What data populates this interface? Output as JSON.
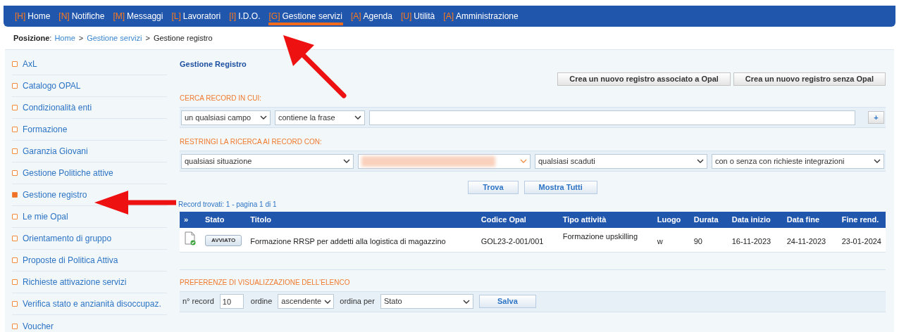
{
  "nav": [
    {
      "key": "[H]",
      "label": "Home",
      "selected": false
    },
    {
      "key": "[N]",
      "label": "Notifiche",
      "selected": false
    },
    {
      "key": "[M]",
      "label": "Messaggi",
      "selected": false
    },
    {
      "key": "[L]",
      "label": "Lavoratori",
      "selected": false
    },
    {
      "key": "[I]",
      "label": "I.D.O.",
      "selected": false
    },
    {
      "key": "[G]",
      "label": "Gestione servizi",
      "selected": true
    },
    {
      "key": "[A]",
      "label": "Agenda",
      "selected": false
    },
    {
      "key": "[U]",
      "label": "Utilità",
      "selected": false
    },
    {
      "key": "[A]",
      "label": "Amministrazione",
      "selected": false
    }
  ],
  "breadcrumb": {
    "label": "Posizione",
    "colon": ":",
    "separator": ">",
    "links": [
      "Home",
      "Gestione servizi"
    ],
    "current": "Gestione registro"
  },
  "sidebar": {
    "items": [
      {
        "label": "AxL",
        "selected": false
      },
      {
        "label": "Catalogo OPAL",
        "selected": false
      },
      {
        "label": "Condizionalità enti",
        "selected": false
      },
      {
        "label": "Formazione",
        "selected": false
      },
      {
        "label": "Garanzia Giovani",
        "selected": false
      },
      {
        "label": "Gestione Politiche attive",
        "selected": false
      },
      {
        "label": "Gestione registro",
        "selected": true
      },
      {
        "label": "Le mie Opal",
        "selected": false
      },
      {
        "label": "Orientamento di gruppo",
        "selected": false
      },
      {
        "label": "Proposte di Politica Attiva",
        "selected": false
      },
      {
        "label": "Richieste attivazione servizi",
        "selected": false
      },
      {
        "label": "Verifica stato e anzianità disoccupaz.",
        "selected": false
      },
      {
        "label": "Voucher",
        "selected": false
      }
    ]
  },
  "page_title": "Gestione Registro",
  "create_buttons": [
    "Crea un nuovo registro associato a Opal",
    "Crea un nuovo registro senza Opal"
  ],
  "search": {
    "heading": "CERCA RECORD IN CUI:",
    "field_select": "un qualsiasi campo",
    "operator_select": "contiene la frase",
    "add_button": "+"
  },
  "filters": {
    "heading": "RESTRINGI LA RICERCA AI RECORD CON:",
    "selects": [
      {
        "value": "qualsiasi situazione",
        "redacted": false
      },
      {
        "redacted": true
      },
      {
        "value": "qualsiasi scaduti",
        "redacted": false
      },
      {
        "value": "con o senza con richieste integrazioni",
        "redacted": false
      }
    ]
  },
  "actions": [
    "Trova",
    "Mostra Tutti"
  ],
  "results_info": "Record trovati: 1 - pagina 1 di 1",
  "table": {
    "columns": [
      "»",
      "Stato",
      "Titolo",
      "Codice Opal",
      "Tipo attività",
      "Luogo",
      "Durata",
      "Data inizio",
      "Data fine",
      "Fine rend."
    ],
    "rows": [
      {
        "stato": "AVVIATO",
        "titolo": "Formazione RRSP per addetti alla logistica di magazzino",
        "codice": "GOL23-2-001/001",
        "tipo": "Formazione upskilling",
        "luogo": "w",
        "durata": "90",
        "data_inizio": "16-11-2023",
        "data_fine": "24-11-2023",
        "fine_rend": "23-01-2024"
      }
    ]
  },
  "preferences": {
    "heading": "PREFERENZE DI VISUALIZZAZIONE DELL'ELENCO",
    "records_label": "n° record",
    "records_value": "10",
    "order_label": "ordine",
    "order_value": "ascendente",
    "sort_label": "ordina per",
    "sort_value": "Stato",
    "save_button": "Salva"
  },
  "annotations": {
    "arrow_to_nav_tab": true,
    "arrow_to_sidebar_item": true
  }
}
